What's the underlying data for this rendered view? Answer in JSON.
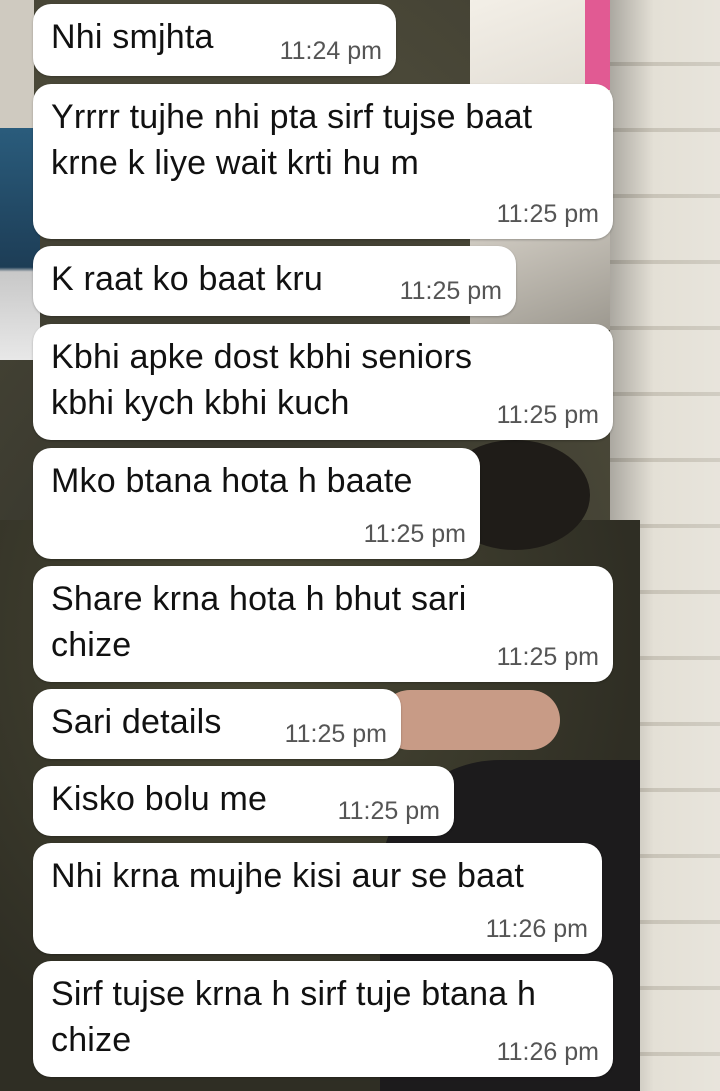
{
  "messages": [
    {
      "text": "Nhi smjhta",
      "time": "11:24 pm"
    },
    {
      "text": "Yrrrr tujhe nhi pta sirf tujse baat krne k liye wait krti hu m",
      "time": "11:25 pm"
    },
    {
      "text": "K raat ko baat kru",
      "time": "11:25 pm"
    },
    {
      "text": "Kbhi apke dost kbhi seniors kbhi kych kbhi kuch",
      "time": "11:25 pm"
    },
    {
      "text": "Mko btana hota h baate",
      "time": "11:25 pm"
    },
    {
      "text": "Share krna hota h bhut sari chize",
      "time": "11:25 pm"
    },
    {
      "text": "Sari details",
      "time": "11:25 pm"
    },
    {
      "text": "Kisko bolu me",
      "time": "11:25 pm"
    },
    {
      "text": "Nhi krna mujhe kisi aur se baat",
      "time": "11:26 pm"
    },
    {
      "text": "Sirf tujse krna h sirf tuje btana h chize",
      "time": "11:26 pm"
    }
  ]
}
